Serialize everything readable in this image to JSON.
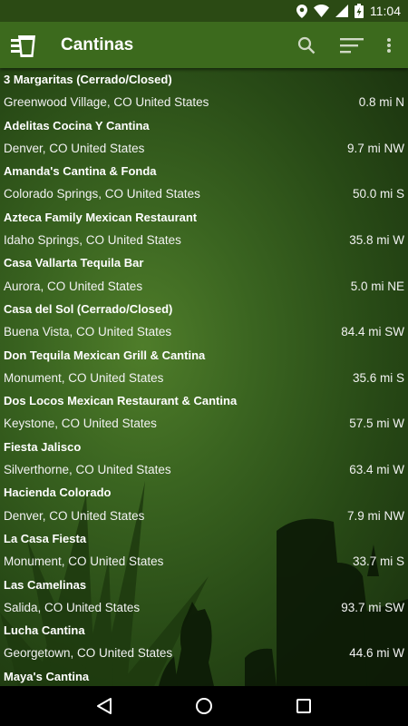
{
  "status_bar": {
    "time": "11:04",
    "icons": [
      "location-icon",
      "wifi-icon",
      "signal-icon",
      "battery-charging-icon"
    ]
  },
  "app_bar": {
    "title": "Cantinas",
    "logo_icon": "drink-glass-icon",
    "actions": [
      "search-icon",
      "sort-icon",
      "overflow-menu-icon"
    ]
  },
  "colors": {
    "app_bar": "#3c6a1d",
    "status_bar": "#2b4a14",
    "background": "#3a6420"
  },
  "list": [
    {
      "name": "3 Margaritas (Cerrado/Closed)",
      "location": "Greenwood Village, CO United States",
      "distance": "0.8 mi N"
    },
    {
      "name": "Adelitas Cocina Y Cantina",
      "location": "Denver, CO United States",
      "distance": "9.7 mi NW"
    },
    {
      "name": "Amanda's Cantina & Fonda",
      "location": "Colorado Springs, CO United States",
      "distance": "50.0 mi S"
    },
    {
      "name": "Azteca Family Mexican Restaurant",
      "location": "Idaho Springs, CO United States",
      "distance": "35.8 mi W"
    },
    {
      "name": "Casa Vallarta Tequila Bar",
      "location": "Aurora, CO United States",
      "distance": "5.0 mi NE"
    },
    {
      "name": "Casa del Sol (Cerrado/Closed)",
      "location": "Buena Vista, CO United States",
      "distance": "84.4 mi SW"
    },
    {
      "name": "Don Tequila Mexican Grill & Cantina",
      "location": "Monument, CO United States",
      "distance": "35.6 mi S"
    },
    {
      "name": "Dos Locos Mexican Restaurant & Cantina",
      "location": "Keystone, CO United States",
      "distance": "57.5 mi W"
    },
    {
      "name": "Fiesta Jalisco",
      "location": "Silverthorne, CO United States",
      "distance": "63.4 mi W"
    },
    {
      "name": "Hacienda Colorado",
      "location": "Denver, CO United States",
      "distance": "7.9 mi NW"
    },
    {
      "name": "La Casa Fiesta",
      "location": "Monument, CO United States",
      "distance": "33.7 mi S"
    },
    {
      "name": "Las Camelinas",
      "location": "Salida, CO United States",
      "distance": "93.7 mi SW"
    },
    {
      "name": "Lucha Cantina",
      "location": "Georgetown, CO United States",
      "distance": "44.6 mi W"
    },
    {
      "name": "Maya's Cantina",
      "location": "",
      "distance": ""
    }
  ],
  "nav_bar": {
    "buttons": [
      "back-icon",
      "home-icon",
      "recents-icon"
    ]
  }
}
